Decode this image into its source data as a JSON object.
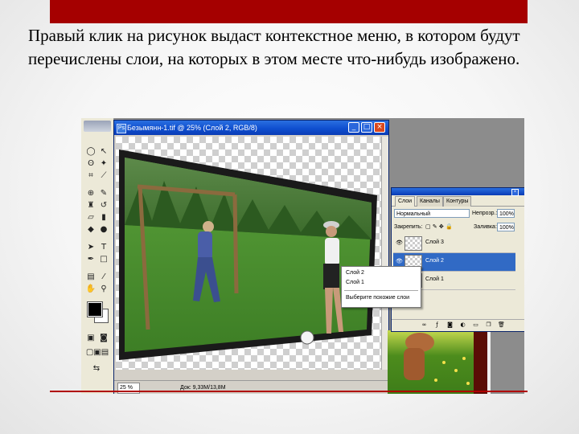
{
  "slide": {
    "caption": "Правый клик на рисунок выдаст контекстное меню, в котором будут перечислены слои, на которых в этом месте что-нибудь изображено.",
    "accent_color": "#a50000"
  },
  "document_window": {
    "title": "Безымянн-1.tif @ 25% (Слой 2, RGB/8)",
    "zoom": "25 %",
    "status_info": "Док: 9,33М/13,8М"
  },
  "layers_palette": {
    "tabs": [
      "Слои",
      "Каналы",
      "Контуры"
    ],
    "blend_mode": "Нормальный",
    "opacity_label": "Непрозр.:",
    "opacity_value": "100%",
    "lock_label": "Закрепить:",
    "fill_label": "Заливка:",
    "fill_value": "100%",
    "layers": [
      {
        "name": "Слой 3",
        "selected": false
      },
      {
        "name": "Слой 2",
        "selected": true
      },
      {
        "name": "Слой 1",
        "selected": false
      }
    ]
  },
  "context_menu": {
    "items": [
      "Слой 2",
      "Слой 1"
    ],
    "action": "Выберите похожие слои"
  },
  "icons": {
    "window_minimize": "minimize-icon",
    "window_maximize": "maximize-icon",
    "window_close": "close-icon",
    "visibility": "eye-icon"
  }
}
